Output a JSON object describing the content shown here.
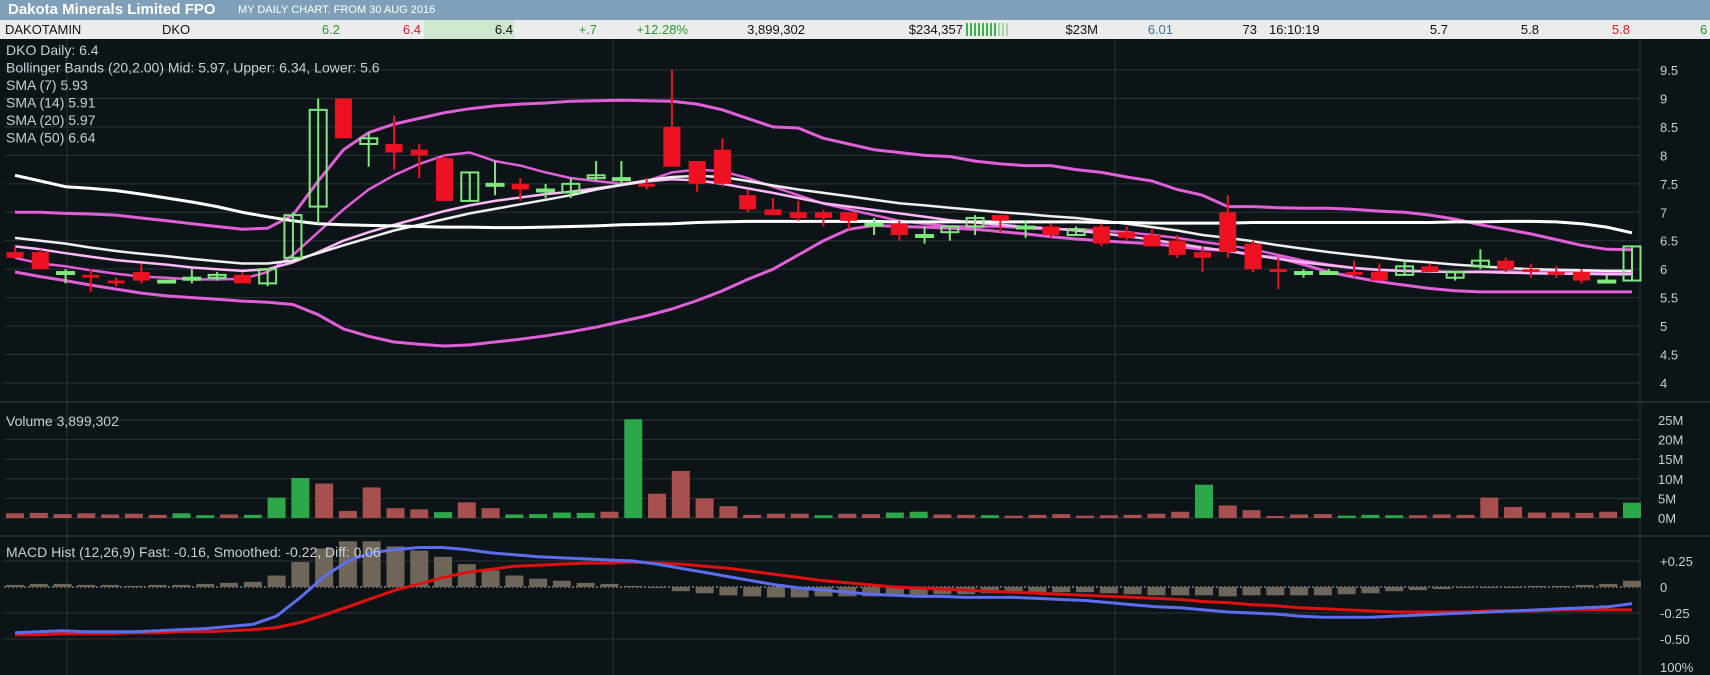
{
  "header": {
    "title": "Dakota Minerals Limited FPO",
    "subtitle": "MY DAILY CHART. FROM 30 AUG 2016"
  },
  "quote": {
    "name": "DAKOTAMIN",
    "code": "DKO",
    "open": "6.2",
    "prev": "6.4",
    "last": "6.4",
    "change": "+.7",
    "pct": "+12.28%",
    "volume": "3,899,302",
    "value": "$234,357",
    "mcap": "$23M",
    "f1": "6.01",
    "trades": "73",
    "time": "16:10:19",
    "bid": "5.7",
    "ask": "5.8",
    "low": "5.8",
    "last_col": "6"
  },
  "colors": {
    "up": "#7ee87e",
    "down": "#ee1122",
    "sma_white": "#ffffff",
    "bollinger": "#e060d8",
    "vol_up": "#2ca84a",
    "vol_down": "#a85050",
    "macd": "#5b6ef0",
    "signal": "#e01010",
    "hist": "#6e6658"
  },
  "chart_data": [
    {
      "type": "candlestick",
      "legend": [
        "DKO Daily: 6.4",
        "Bollinger Bands (20,2.00) Mid: 5.97, Upper: 6.34, Lower: 5.6",
        "SMA (7) 5.93",
        "SMA (14) 5.91",
        "SMA (20) 5.97",
        "SMA (50) 6.64"
      ],
      "y_ticks": [
        "9.5",
        "9",
        "8.5",
        "8",
        "7.5",
        "7",
        "6.5",
        "6",
        "5.5",
        "5",
        "4.5",
        "4"
      ],
      "ylim": [
        4,
        9.5
      ],
      "candles": [
        {
          "o": 6.3,
          "h": 6.4,
          "l": 6.2,
          "c": 6.2
        },
        {
          "o": 6.3,
          "h": 6.35,
          "l": 6.0,
          "c": 6.0
        },
        {
          "o": 5.95,
          "h": 6.0,
          "l": 5.75,
          "c": 5.95
        },
        {
          "o": 5.9,
          "h": 6.0,
          "l": 5.6,
          "c": 5.85
        },
        {
          "o": 5.8,
          "h": 5.85,
          "l": 5.7,
          "c": 5.75
        },
        {
          "o": 5.95,
          "h": 6.1,
          "l": 5.75,
          "c": 5.8
        },
        {
          "o": 5.8,
          "h": 5.8,
          "l": 5.8,
          "c": 5.8
        },
        {
          "o": 5.85,
          "h": 6.0,
          "l": 5.75,
          "c": 5.85
        },
        {
          "o": 5.85,
          "h": 5.95,
          "l": 5.8,
          "c": 5.9
        },
        {
          "o": 5.9,
          "h": 5.95,
          "l": 5.75,
          "c": 5.75
        },
        {
          "o": 5.75,
          "h": 6.0,
          "l": 5.7,
          "c": 6.0
        },
        {
          "o": 6.2,
          "h": 7.0,
          "l": 6.2,
          "c": 6.95
        },
        {
          "o": 7.1,
          "h": 9.0,
          "l": 6.8,
          "c": 8.8
        },
        {
          "o": 9.0,
          "h": 9.0,
          "l": 8.3,
          "c": 8.3
        },
        {
          "o": 8.2,
          "h": 8.4,
          "l": 7.8,
          "c": 8.3
        },
        {
          "o": 8.2,
          "h": 8.7,
          "l": 7.75,
          "c": 8.05
        },
        {
          "o": 8.1,
          "h": 8.2,
          "l": 7.6,
          "c": 8.0
        },
        {
          "o": 7.95,
          "h": 8.0,
          "l": 7.2,
          "c": 7.2
        },
        {
          "o": 7.2,
          "h": 7.7,
          "l": 7.2,
          "c": 7.7
        },
        {
          "o": 7.5,
          "h": 7.9,
          "l": 7.3,
          "c": 7.5
        },
        {
          "o": 7.5,
          "h": 7.6,
          "l": 7.2,
          "c": 7.4
        },
        {
          "o": 7.4,
          "h": 7.5,
          "l": 7.25,
          "c": 7.4
        },
        {
          "o": 7.35,
          "h": 7.6,
          "l": 7.25,
          "c": 7.5
        },
        {
          "o": 7.6,
          "h": 7.9,
          "l": 7.55,
          "c": 7.65
        },
        {
          "o": 7.6,
          "h": 7.9,
          "l": 7.5,
          "c": 7.6
        },
        {
          "o": 7.5,
          "h": 7.6,
          "l": 7.4,
          "c": 7.45
        },
        {
          "o": 8.5,
          "h": 9.5,
          "l": 7.8,
          "c": 7.8
        },
        {
          "o": 7.9,
          "h": 7.9,
          "l": 7.35,
          "c": 7.5
        },
        {
          "o": 8.1,
          "h": 8.3,
          "l": 7.45,
          "c": 7.5
        },
        {
          "o": 7.3,
          "h": 7.4,
          "l": 7.0,
          "c": 7.05
        },
        {
          "o": 7.05,
          "h": 7.25,
          "l": 6.95,
          "c": 6.95
        },
        {
          "o": 7.0,
          "h": 7.2,
          "l": 6.85,
          "c": 6.9
        },
        {
          "o": 7.0,
          "h": 7.05,
          "l": 6.75,
          "c": 6.9
        },
        {
          "o": 7.0,
          "h": 7.0,
          "l": 6.7,
          "c": 6.85
        },
        {
          "o": 6.8,
          "h": 6.9,
          "l": 6.6,
          "c": 6.8
        },
        {
          "o": 6.8,
          "h": 6.85,
          "l": 6.5,
          "c": 6.6
        },
        {
          "o": 6.6,
          "h": 6.75,
          "l": 6.45,
          "c": 6.6
        },
        {
          "o": 6.65,
          "h": 6.75,
          "l": 6.5,
          "c": 6.75
        },
        {
          "o": 6.75,
          "h": 6.95,
          "l": 6.6,
          "c": 6.9
        },
        {
          "o": 6.95,
          "h": 6.95,
          "l": 6.65,
          "c": 6.85
        },
        {
          "o": 6.75,
          "h": 6.85,
          "l": 6.55,
          "c": 6.75
        },
        {
          "o": 6.75,
          "h": 6.8,
          "l": 6.55,
          "c": 6.6
        },
        {
          "o": 6.6,
          "h": 6.75,
          "l": 6.6,
          "c": 6.7
        },
        {
          "o": 6.75,
          "h": 6.8,
          "l": 6.4,
          "c": 6.45
        },
        {
          "o": 6.65,
          "h": 6.75,
          "l": 6.5,
          "c": 6.55
        },
        {
          "o": 6.6,
          "h": 6.7,
          "l": 6.4,
          "c": 6.4
        },
        {
          "o": 6.5,
          "h": 6.6,
          "l": 6.2,
          "c": 6.25
        },
        {
          "o": 6.3,
          "h": 6.4,
          "l": 5.95,
          "c": 6.2
        },
        {
          "o": 7.0,
          "h": 7.3,
          "l": 6.2,
          "c": 6.3
        },
        {
          "o": 6.45,
          "h": 6.5,
          "l": 5.95,
          "c": 6.0
        },
        {
          "o": 6.0,
          "h": 6.2,
          "l": 5.65,
          "c": 5.95
        },
        {
          "o": 5.95,
          "h": 6.0,
          "l": 5.85,
          "c": 5.95
        },
        {
          "o": 5.95,
          "h": 6.0,
          "l": 5.9,
          "c": 5.95
        },
        {
          "o": 5.95,
          "h": 6.15,
          "l": 5.85,
          "c": 5.9
        },
        {
          "o": 5.95,
          "h": 6.1,
          "l": 5.8,
          "c": 5.8
        },
        {
          "o": 5.9,
          "h": 6.15,
          "l": 5.9,
          "c": 6.05
        },
        {
          "o": 6.05,
          "h": 6.1,
          "l": 5.95,
          "c": 5.95
        },
        {
          "o": 5.85,
          "h": 5.95,
          "l": 5.8,
          "c": 5.95
        },
        {
          "o": 6.05,
          "h": 6.35,
          "l": 6.0,
          "c": 6.15
        },
        {
          "o": 6.15,
          "h": 6.2,
          "l": 5.95,
          "c": 6.0
        },
        {
          "o": 6.0,
          "h": 6.1,
          "l": 5.85,
          "c": 5.95
        },
        {
          "o": 5.95,
          "h": 6.05,
          "l": 5.85,
          "c": 5.9
        },
        {
          "o": 5.95,
          "h": 6.0,
          "l": 5.75,
          "c": 5.8
        },
        {
          "o": 5.8,
          "h": 5.9,
          "l": 5.75,
          "c": 5.8
        },
        {
          "o": 5.8,
          "h": 6.4,
          "l": 5.8,
          "c": 6.4
        }
      ],
      "sma50": [
        7.65,
        7.55,
        7.45,
        7.42,
        7.38,
        7.32,
        7.25,
        7.18,
        7.1,
        7.0,
        6.92,
        6.85,
        6.8,
        6.78,
        6.77,
        6.76,
        6.75,
        6.74,
        6.74,
        6.73,
        6.73,
        6.74,
        6.75,
        6.76,
        6.78,
        6.79,
        6.8,
        6.82,
        6.83,
        6.84,
        6.84,
        6.84,
        6.84,
        6.84,
        6.84,
        6.83,
        6.83,
        6.83,
        6.83,
        6.83,
        6.83,
        6.83,
        6.83,
        6.82,
        6.82,
        6.81,
        6.81,
        6.81,
        6.81,
        6.82,
        6.82,
        6.82,
        6.82,
        6.82,
        6.82,
        6.82,
        6.82,
        6.83,
        6.83,
        6.84,
        6.84,
        6.83,
        6.8,
        6.74,
        6.64
      ],
      "sma20": [
        6.55,
        6.5,
        6.45,
        6.38,
        6.32,
        6.27,
        6.23,
        6.18,
        6.14,
        6.1,
        6.1,
        6.15,
        6.28,
        6.42,
        6.55,
        6.68,
        6.78,
        6.88,
        6.98,
        7.06,
        7.14,
        7.22,
        7.3,
        7.4,
        7.48,
        7.56,
        7.62,
        7.64,
        7.62,
        7.55,
        7.47,
        7.4,
        7.34,
        7.28,
        7.22,
        7.16,
        7.12,
        7.08,
        7.04,
        7.0,
        6.97,
        6.93,
        6.9,
        6.85,
        6.8,
        6.74,
        6.68,
        6.6,
        6.55,
        6.49,
        6.42,
        6.36,
        6.3,
        6.25,
        6.2,
        6.15,
        6.12,
        6.08,
        6.05,
        6.02,
        6.0,
        5.99,
        5.98,
        5.97,
        5.97
      ],
      "sma14": [
        6.4,
        6.35,
        6.28,
        6.22,
        6.16,
        6.12,
        6.08,
        6.03,
        6.0,
        5.97,
        6.0,
        6.12,
        6.3,
        6.5,
        6.65,
        6.78,
        6.9,
        7.02,
        7.12,
        7.2,
        7.26,
        7.32,
        7.36,
        7.42,
        7.48,
        7.54,
        7.58,
        7.56,
        7.5,
        7.42,
        7.34,
        7.25,
        7.16,
        7.1,
        7.04,
        6.98,
        6.92,
        6.86,
        6.82,
        6.78,
        6.74,
        6.72,
        6.68,
        6.63,
        6.58,
        6.52,
        6.45,
        6.38,
        6.32,
        6.25,
        6.18,
        6.12,
        6.07,
        6.02,
        5.99,
        5.97,
        5.96,
        5.95,
        5.95,
        5.94,
        5.93,
        5.92,
        5.92,
        5.91,
        5.91
      ],
      "sma7": [
        6.2,
        6.1,
        6.05,
        5.98,
        5.92,
        5.87,
        5.85,
        5.82,
        5.82,
        5.83,
        5.95,
        6.25,
        6.65,
        7.05,
        7.4,
        7.65,
        7.85,
        8.0,
        8.05,
        7.9,
        7.82,
        7.7,
        7.6,
        7.55,
        7.5,
        7.55,
        7.7,
        7.75,
        7.72,
        7.6,
        7.45,
        7.3,
        7.15,
        7.05,
        6.95,
        6.85,
        6.8,
        6.75,
        6.75,
        6.75,
        6.72,
        6.7,
        6.7,
        6.68,
        6.65,
        6.6,
        6.55,
        6.48,
        6.42,
        6.35,
        6.25,
        6.15,
        6.08,
        6.02,
        5.98,
        5.97,
        5.96,
        5.95,
        5.96,
        5.96,
        5.95,
        5.95,
        5.94,
        5.93,
        5.93
      ],
      "bb_upper": [
        7.0,
        7.0,
        6.98,
        6.97,
        6.95,
        6.9,
        6.85,
        6.8,
        6.75,
        6.7,
        6.72,
        6.95,
        7.55,
        8.1,
        8.4,
        8.55,
        8.65,
        8.75,
        8.82,
        8.87,
        8.9,
        8.92,
        8.95,
        8.96,
        8.97,
        8.96,
        8.95,
        8.9,
        8.8,
        8.65,
        8.5,
        8.48,
        8.3,
        8.2,
        8.1,
        8.05,
        8.0,
        7.98,
        7.9,
        7.85,
        7.82,
        7.82,
        7.75,
        7.7,
        7.62,
        7.55,
        7.4,
        7.3,
        7.1,
        7.1,
        7.08,
        7.07,
        7.07,
        7.05,
        7.02,
        7.0,
        6.95,
        6.88,
        6.78,
        6.7,
        6.62,
        6.52,
        6.42,
        6.35,
        6.34
      ],
      "bb_lower": [
        5.95,
        5.87,
        5.8,
        5.72,
        5.65,
        5.58,
        5.53,
        5.5,
        5.47,
        5.44,
        5.42,
        5.38,
        5.2,
        4.95,
        4.82,
        4.72,
        4.68,
        4.65,
        4.67,
        4.72,
        4.77,
        4.83,
        4.9,
        4.98,
        5.08,
        5.18,
        5.3,
        5.45,
        5.62,
        5.82,
        6.0,
        6.25,
        6.5,
        6.7,
        6.77,
        6.75,
        6.74,
        6.72,
        6.7,
        6.66,
        6.62,
        6.57,
        6.53,
        6.5,
        6.47,
        6.45,
        6.4,
        6.35,
        6.33,
        6.25,
        6.2,
        6.08,
        5.95,
        5.86,
        5.78,
        5.72,
        5.66,
        5.62,
        5.6,
        5.6,
        5.6,
        5.6,
        5.6,
        5.6,
        5.6
      ]
    },
    {
      "type": "bar",
      "legend": "Volume 3,899,302",
      "y_ticks": [
        "25M",
        "20M",
        "15M",
        "10M",
        "5M",
        "0M"
      ],
      "ylim": [
        0,
        25
      ],
      "unit": "M",
      "values": [
        1.2,
        1.3,
        1.0,
        1.2,
        0.9,
        1.1,
        0.8,
        1.2,
        0.7,
        0.9,
        0.8,
        5.2,
        10.2,
        8.8,
        1.8,
        7.8,
        2.5,
        2.2,
        1.5,
        4.0,
        2.5,
        0.9,
        1.0,
        1.4,
        1.3,
        1.6,
        25.2,
        6.2,
        12.0,
        5.0,
        3.0,
        0.8,
        1.1,
        1.1,
        0.7,
        1.1,
        1.0,
        1.4,
        1.6,
        0.9,
        0.8,
        0.7,
        0.6,
        0.8,
        1.0,
        0.6,
        0.7,
        0.8,
        1.1,
        1.6,
        8.5,
        3.2,
        2.0,
        0.5,
        0.9,
        1.0,
        0.6,
        0.8,
        0.7,
        0.7,
        0.9,
        0.8,
        5.2,
        2.8,
        1.4,
        1.4,
        1.3,
        1.6,
        3.9
      ],
      "up": [
        false,
        false,
        false,
        false,
        false,
        false,
        false,
        true,
        true,
        false,
        true,
        true,
        true,
        false,
        false,
        false,
        false,
        false,
        true,
        false,
        false,
        true,
        true,
        true,
        true,
        false,
        true,
        false,
        false,
        false,
        false,
        false,
        false,
        false,
        true,
        false,
        false,
        true,
        true,
        false,
        false,
        true,
        false,
        false,
        false,
        false,
        false,
        false,
        false,
        false,
        true,
        false,
        false,
        false,
        false,
        false,
        true,
        true,
        true,
        false,
        false,
        false,
        false,
        false,
        false,
        false,
        false,
        false,
        true
      ]
    },
    {
      "type": "line",
      "legend": "MACD Hist (12,26,9) Fast: -0.16, Smoothed: -0.22, Diff: 0.06",
      "y_ticks": [
        "+0.25",
        "0",
        "-0.25",
        "-0.50"
      ],
      "ylim": [
        -0.6,
        0.35
      ],
      "bottom_label": "100%",
      "macd": [
        -0.44,
        -0.43,
        -0.42,
        -0.43,
        -0.43,
        -0.43,
        -0.42,
        -0.41,
        -0.4,
        -0.38,
        -0.36,
        -0.28,
        -0.1,
        0.1,
        0.25,
        0.33,
        0.36,
        0.38,
        0.38,
        0.36,
        0.33,
        0.31,
        0.29,
        0.28,
        0.27,
        0.26,
        0.25,
        0.22,
        0.18,
        0.14,
        0.1,
        0.06,
        0.02,
        -0.01,
        -0.03,
        -0.05,
        -0.07,
        -0.08,
        -0.09,
        -0.09,
        -0.1,
        -0.1,
        -0.1,
        -0.11,
        -0.12,
        -0.13,
        -0.15,
        -0.17,
        -0.19,
        -0.2,
        -0.22,
        -0.24,
        -0.25,
        -0.26,
        -0.28,
        -0.29,
        -0.29,
        -0.29,
        -0.28,
        -0.27,
        -0.26,
        -0.25,
        -0.24,
        -0.23,
        -0.22,
        -0.21,
        -0.2,
        -0.19,
        -0.16
      ],
      "signal": [
        -0.46,
        -0.46,
        -0.45,
        -0.45,
        -0.45,
        -0.44,
        -0.44,
        -0.43,
        -0.43,
        -0.42,
        -0.41,
        -0.39,
        -0.34,
        -0.27,
        -0.19,
        -0.11,
        -0.03,
        0.03,
        0.09,
        0.14,
        0.17,
        0.2,
        0.21,
        0.22,
        0.23,
        0.23,
        0.24,
        0.23,
        0.22,
        0.2,
        0.18,
        0.15,
        0.12,
        0.09,
        0.06,
        0.04,
        0.02,
        0.0,
        -0.01,
        -0.02,
        -0.03,
        -0.04,
        -0.05,
        -0.06,
        -0.07,
        -0.08,
        -0.09,
        -0.1,
        -0.11,
        -0.12,
        -0.14,
        -0.15,
        -0.17,
        -0.18,
        -0.2,
        -0.21,
        -0.22,
        -0.23,
        -0.24,
        -0.24,
        -0.24,
        -0.24,
        -0.23,
        -0.23,
        -0.23,
        -0.22,
        -0.22,
        -0.22,
        -0.22
      ]
    }
  ]
}
